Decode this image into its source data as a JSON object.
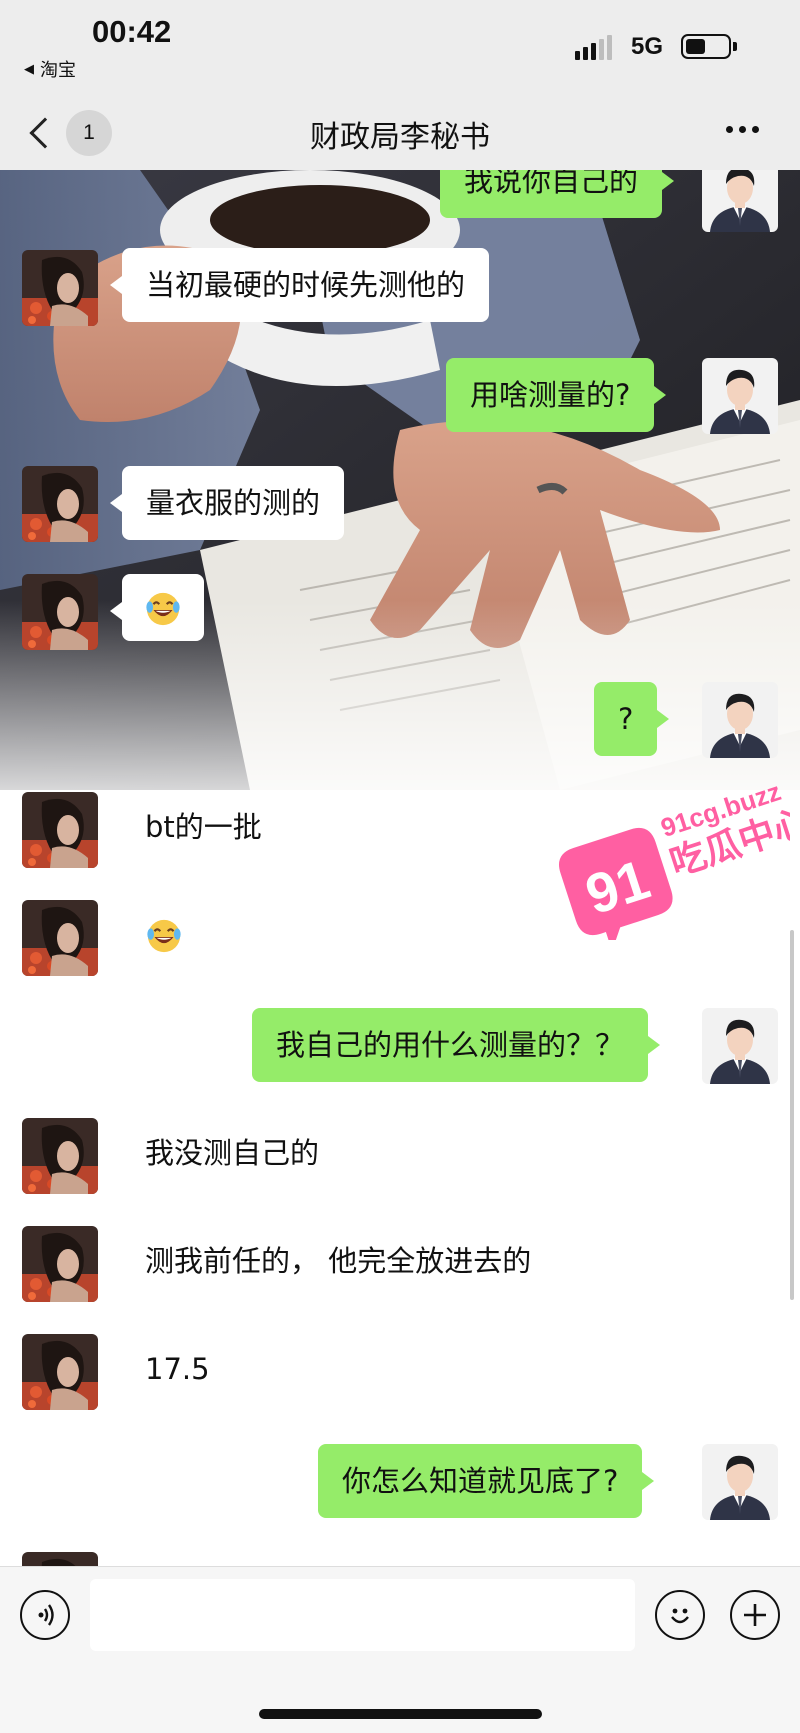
{
  "status_bar": {
    "time": "00:42",
    "back_app": "淘宝",
    "network": "5G",
    "battery_level": 0.48
  },
  "nav": {
    "unread_count": "1",
    "title": "财政局李秘书"
  },
  "messages": [
    {
      "side": "right",
      "text": "我说你自己的"
    },
    {
      "side": "left",
      "text": "当初最硬的时候先测他的"
    },
    {
      "side": "right",
      "text": "用啥测量的?"
    },
    {
      "side": "left",
      "text": "量衣服的测的"
    },
    {
      "side": "left",
      "emoji": "laughing-tears-emoji"
    },
    {
      "side": "right",
      "text": "?"
    },
    {
      "side": "left",
      "text": "bt的一批"
    },
    {
      "side": "left",
      "emoji": "laughing-tears-emoji"
    },
    {
      "side": "right",
      "text": "我自己的用什么测量的？？"
    },
    {
      "side": "left",
      "text": "我没测自己的"
    },
    {
      "side": "left",
      "text": "测我前任的，  他完全放进去的"
    },
    {
      "side": "left",
      "text": "17.5"
    },
    {
      "side": "right",
      "text": "你怎么知道就见底了?"
    }
  ],
  "watermark": {
    "number": "91",
    "domain": "91cg.buzz",
    "name": "吃瓜中心"
  },
  "colors": {
    "sent_bubble": "#95ec69",
    "received_bubble": "#ffffff",
    "watermark": "#ff5fa2"
  }
}
